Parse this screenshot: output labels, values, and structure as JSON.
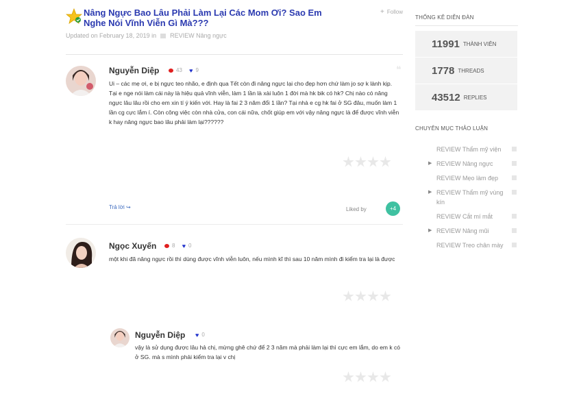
{
  "topic": {
    "title": "Nâng Ngực Bao Lâu Phải Làm Lại Các Mom Ơi? Sao Em Nghe Nói Vĩnh Viễn Gì Mà???",
    "follow_label": "Follow",
    "updated": "Updated on February 18, 2019",
    "in_word": "in",
    "category": "REVIEW Nâng ngực"
  },
  "posts": [
    {
      "author": "Nguyễn Diệp",
      "comments": "43",
      "likes": "9",
      "body": "Ui – các mẹ ơi, e bị ngực teo nhão, e định qua Tết còn đi nâng ngực lại cho đẹp hơn chứ làm jo sợ k lành kịp. Tại e nge nói làm cái này là hiệu quả vĩnh viễn, làm 1 lần là xài luôn 1 đời mà hk bik có hk? Chị nào có nâng ngực lâu lâu rồi cho em xin tí ý kiến với. Hay là fai 2 3 năm đổi 1 lần? Tại nhà e cg hk fai ở SG đâu, muốn làm 1 lần cg cực lắm í. Còn công việc còn nhà cửa, con cái nữa, chốt giúp em với vậy nâng ngực là để được vĩnh viễn k hay nâng ngực bao lâu phải làm lại??????",
      "reply_label": "Trả lời",
      "liked_by_label": "Liked by",
      "liked_count": "+4"
    },
    {
      "author": "Ngọc Xuyến",
      "comments": "8",
      "likes": "0",
      "body": "một khi đã nâng ngực rồi thì dùng được vĩnh viễn luôn, nếu mình kĩ thì sau 10 năm mình đi kiểm tra lại là được"
    },
    {
      "author": "Nguyễn Diệp",
      "likes": "0",
      "body": "vậy là sử dụng được lâu hả chị, mừng ghê chứ để 2 3 năm mà phải làm lại thì cực em lắm, do em k có ở SG. mà s mình phải kiểm tra lại v chị"
    }
  ],
  "sidebar": {
    "stats_title": "THỐNG KÊ DIỄN ĐÀN",
    "stats": [
      {
        "value": "11991",
        "label": "THÀNH VIÊN"
      },
      {
        "value": "1778",
        "label": "THREADS"
      },
      {
        "value": "43512",
        "label": "REPLIES"
      }
    ],
    "forums_title": "CHUYÊN MỤC THẢO LUẬN",
    "forums": [
      {
        "label": "REVIEW Thẩm mỹ viện",
        "expandable": false
      },
      {
        "label": "REVIEW Nâng ngực",
        "expandable": true
      },
      {
        "label": "REVIEW Mẹo làm đẹp",
        "expandable": false
      },
      {
        "label": "REVIEW Thẩm mỹ vùng kín",
        "expandable": true
      },
      {
        "label": "REVIEW Cắt mí mắt",
        "expandable": false
      },
      {
        "label": "REVIEW Nâng mũi",
        "expandable": true
      },
      {
        "label": "REVIEW Treo chân mày",
        "expandable": false
      }
    ]
  },
  "colors": {
    "title": "#2b3ab0",
    "accent": "#3fc1a1",
    "comment_bubble": "#e02020",
    "heart": "#2233cc",
    "link": "#3d6bbf"
  },
  "icons": [
    "star-icon",
    "follow-plus-icon",
    "folder-icon",
    "comment-icon",
    "heart-icon",
    "quote-icon",
    "share-icon",
    "chevron-right-icon"
  ]
}
